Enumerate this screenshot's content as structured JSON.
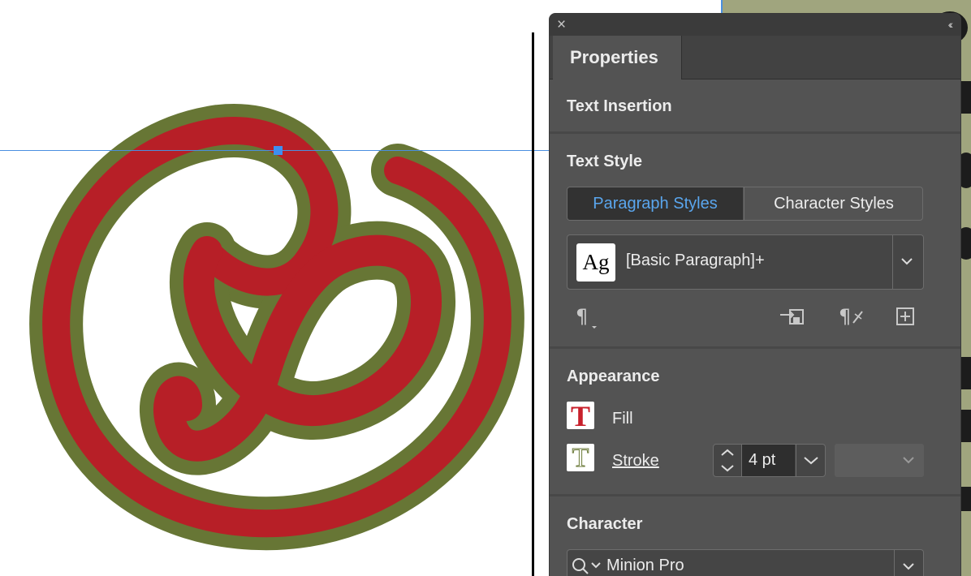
{
  "panel": {
    "tab": "Properties",
    "sections": {
      "text_insertion": "Text Insertion",
      "text_style": "Text Style",
      "appearance": "Appearance",
      "character": "Character"
    }
  },
  "text_style": {
    "paragraph_styles": "Paragraph Styles",
    "character_styles": "Character Styles",
    "preview": "Ag",
    "style_name": "[Basic Paragraph]+"
  },
  "appearance": {
    "fill_label": "Fill",
    "stroke_label": "Stroke",
    "stroke_weight": "4 pt",
    "fill_swatch_glyph": "T",
    "stroke_swatch_glyph": "T"
  },
  "character": {
    "font_family": "Minion Pro"
  },
  "colors": {
    "artwork_fill": "#b71f27",
    "artwork_stroke": "#677635",
    "accent": "#5aa6ee",
    "text_frame": "#a0a57e"
  }
}
